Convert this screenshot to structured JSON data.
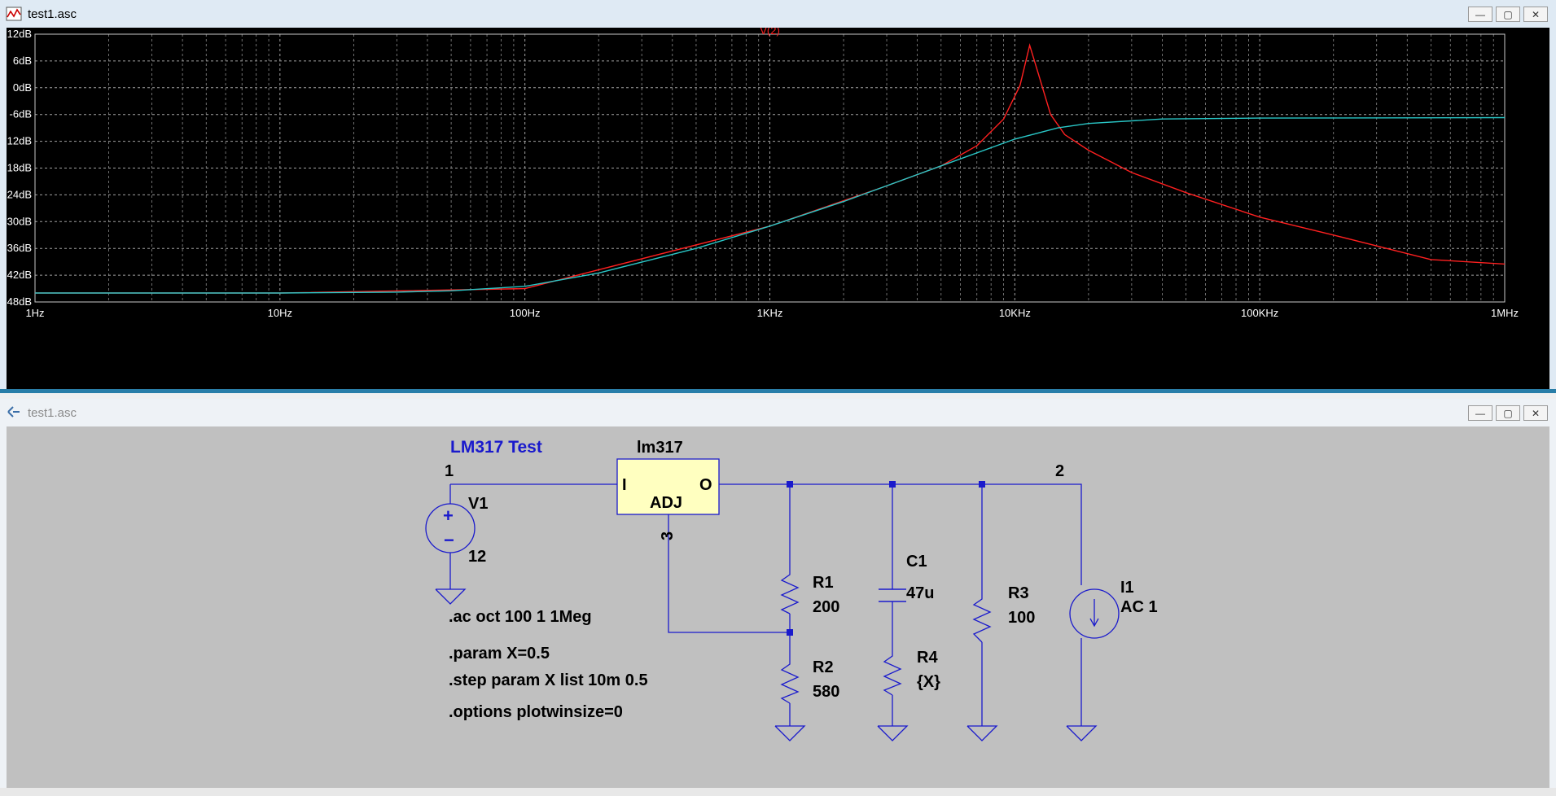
{
  "plot_window": {
    "title": "test1.asc",
    "buttons": {
      "minimize": "—",
      "maximize": "▢",
      "close": "✕"
    }
  },
  "chart_data": {
    "type": "line",
    "title": "V(2)",
    "x_scale": "log",
    "xlim": [
      1,
      1000000
    ],
    "ylim": [
      -48,
      12
    ],
    "x_tick_labels": [
      "1Hz",
      "10Hz",
      "100Hz",
      "1KHz",
      "10KHz",
      "100KHz",
      "1MHz"
    ],
    "y_tick_labels": [
      "12dB",
      "6dB",
      "0dB",
      "-6dB",
      "-12dB",
      "-18dB",
      "-24dB",
      "-30dB",
      "-36dB",
      "-42dB",
      "-48dB"
    ],
    "grid": true,
    "series": [
      {
        "color": "#ff2020",
        "x": [
          1,
          10,
          100,
          1000,
          3000,
          5000,
          7000,
          9000,
          10500,
          11500,
          12500,
          14000,
          16000,
          20000,
          30000,
          50000,
          100000,
          200000,
          500000,
          1000000
        ],
        "y": [
          -46.0,
          -46.0,
          -45.0,
          -31.0,
          -22.0,
          -17.5,
          -13.0,
          -7.0,
          0.5,
          9.5,
          3.0,
          -6.0,
          -10.5,
          -14.0,
          -19.0,
          -23.5,
          -29.0,
          -33.0,
          -38.5,
          -39.5
        ]
      },
      {
        "color": "#29c6c6",
        "x": [
          1,
          10,
          30,
          50,
          100,
          200,
          500,
          1000,
          2000,
          5000,
          10000,
          15000,
          20000,
          40000,
          100000,
          1000000
        ],
        "y": [
          -46.0,
          -46.0,
          -45.8,
          -45.5,
          -44.5,
          -41.5,
          -36.0,
          -31.0,
          -25.5,
          -17.5,
          -11.5,
          -9.0,
          -8.0,
          -7.0,
          -6.8,
          -6.7
        ]
      }
    ]
  },
  "schematic_window": {
    "title": "test1.asc",
    "buttons": {
      "minimize": "—",
      "maximize": "▢",
      "close": "✕"
    }
  },
  "schematic": {
    "title": "LM317 Test",
    "regulator": {
      "name": "lm317",
      "pin_in": "I",
      "pin_out": "O",
      "pin_adj": "ADJ"
    },
    "nodes": {
      "n1": "1",
      "n2": "2",
      "n3": "3"
    },
    "v1": {
      "name": "V1",
      "value": "12",
      "plus": "+",
      "minus": "−"
    },
    "r1": {
      "name": "R1",
      "value": "200"
    },
    "r2": {
      "name": "R2",
      "value": "580"
    },
    "c1": {
      "name": "C1",
      "value": "47u"
    },
    "r4": {
      "name": "R4",
      "value": "{X}"
    },
    "r3": {
      "name": "R3",
      "value": "100"
    },
    "i1": {
      "name": "I1",
      "value": "AC 1"
    },
    "directives": [
      ".ac oct 100 1 1Meg",
      ".param X=0.5",
      ".step param X list 10m 0.5",
      ".options plotwinsize=0"
    ]
  }
}
